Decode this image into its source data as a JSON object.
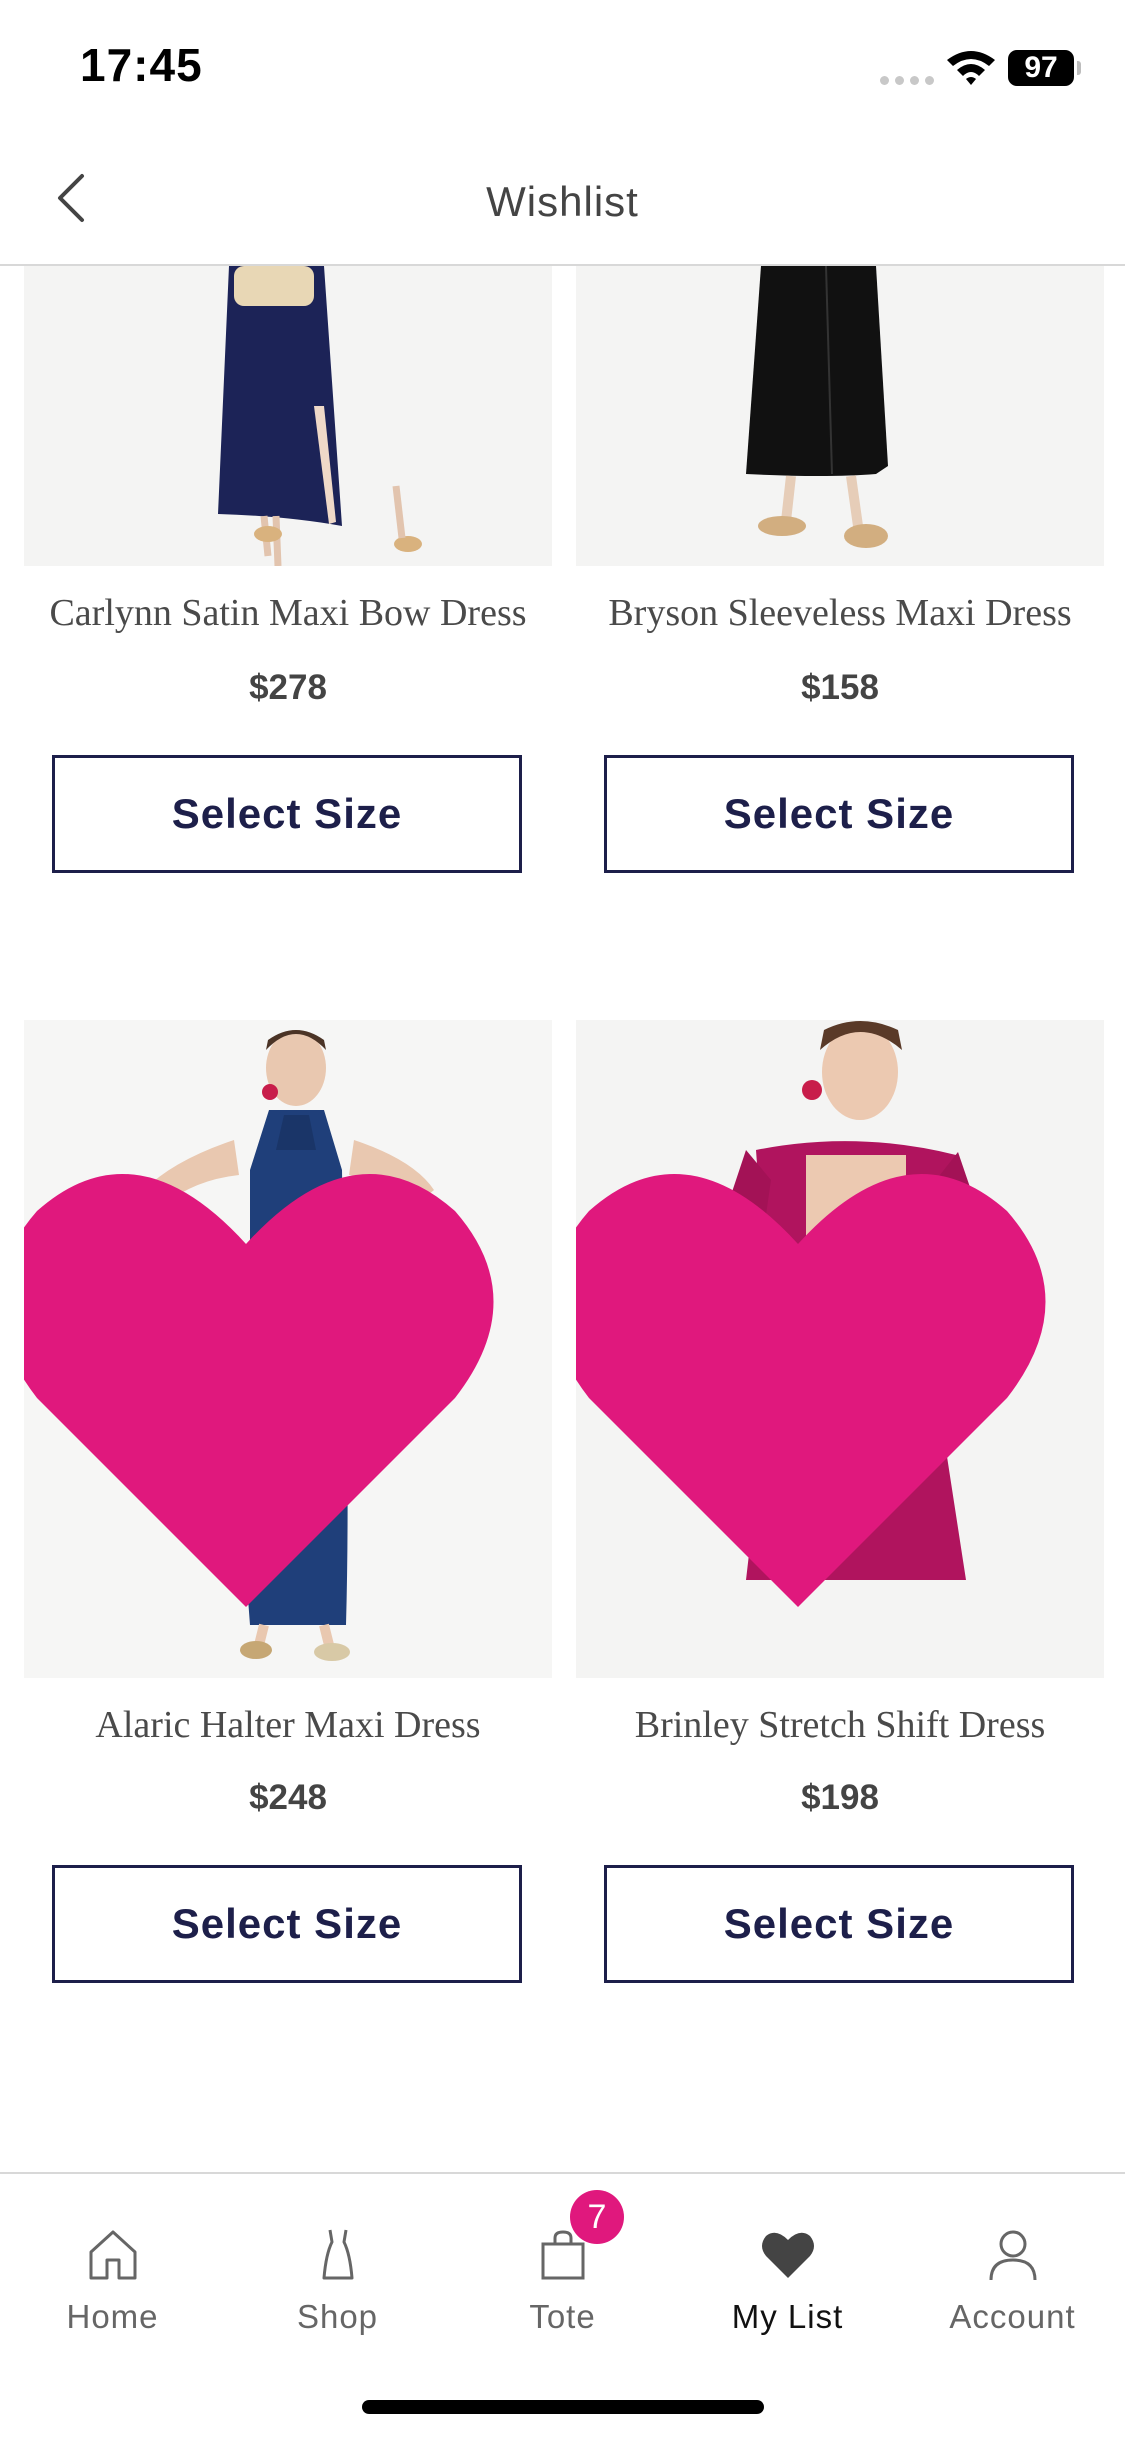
{
  "status_bar": {
    "time": "17:45",
    "battery": "97"
  },
  "header": {
    "title": "Wishlist"
  },
  "colors": {
    "accent": "#e0187d",
    "button_border": "#1d1f4a"
  },
  "products": [
    {
      "name": "Carlynn Satin Maxi Bow Dress",
      "price": "$278",
      "button_label": "Select Size",
      "dress_color": "#1c2357"
    },
    {
      "name": "Bryson Sleeveless Maxi Dress",
      "price": "$158",
      "button_label": "Select Size",
      "dress_color": "#111111"
    },
    {
      "name": "Alaric Halter Maxi Dress",
      "price": "$248",
      "button_label": "Select Size",
      "dress_color": "#1f3f7a",
      "favorited": true
    },
    {
      "name": "Brinley Stretch Shift Dress",
      "price": "$198",
      "button_label": "Select Size",
      "dress_color": "#b0145e",
      "favorited": true
    }
  ],
  "tab_bar": {
    "tabs": [
      {
        "label": "Home",
        "icon": "home-icon"
      },
      {
        "label": "Shop",
        "icon": "dress-icon"
      },
      {
        "label": "Tote",
        "icon": "bag-icon"
      },
      {
        "label": "My List",
        "icon": "heart-icon"
      },
      {
        "label": "Account",
        "icon": "person-icon"
      }
    ],
    "tote_badge": "7",
    "active": "My List"
  }
}
